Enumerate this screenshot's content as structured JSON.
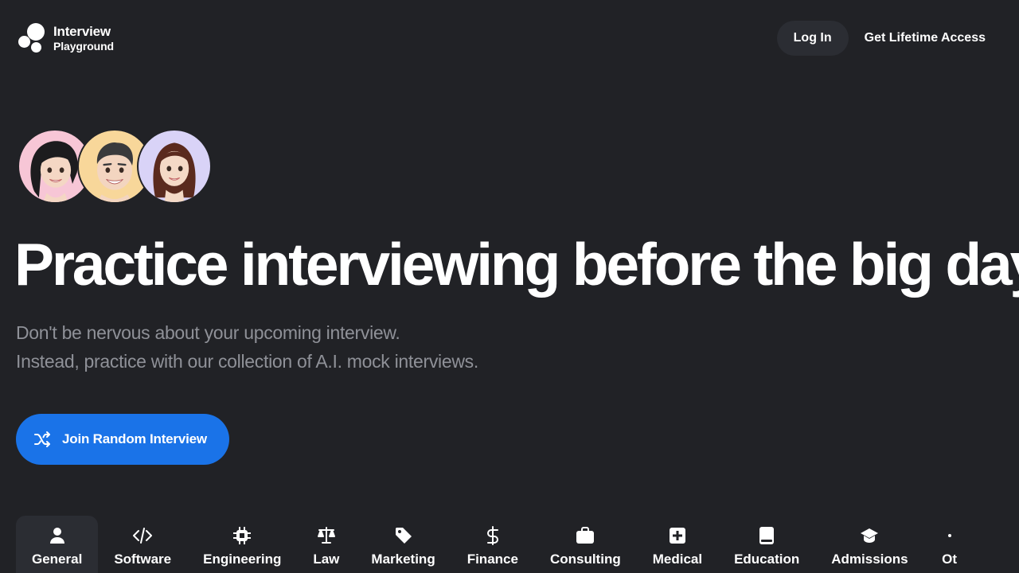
{
  "brand": {
    "name_line1": "Interview",
    "name_line2": "Playground"
  },
  "nav": {
    "login_label": "Log In",
    "lifetime_label": "Get Lifetime Access"
  },
  "hero": {
    "avatars": [
      "avatar-woman-dark-hair",
      "avatar-man-short-hair",
      "avatar-woman-brown-hair"
    ],
    "headline": "Practice interviewing before the big day",
    "subtitle_line1": "Don't be nervous about your upcoming interview.",
    "subtitle_line2": "Instead, practice with our collection of A.I. mock interviews.",
    "cta_label": "Join Random Interview",
    "cta_icon": "shuffle-icon"
  },
  "categories": [
    {
      "label": "General",
      "icon": "user-icon",
      "active": true
    },
    {
      "label": "Software",
      "icon": "code-icon"
    },
    {
      "label": "Engineering",
      "icon": "chip-icon"
    },
    {
      "label": "Law",
      "icon": "scale-icon"
    },
    {
      "label": "Marketing",
      "icon": "tag-icon"
    },
    {
      "label": "Finance",
      "icon": "dollar-icon"
    },
    {
      "label": "Consulting",
      "icon": "briefcase-icon"
    },
    {
      "label": "Medical",
      "icon": "medical-plus-icon"
    },
    {
      "label": "Education",
      "icon": "book-icon"
    },
    {
      "label": "Admissions",
      "icon": "graduation-cap-icon"
    },
    {
      "label": "Ot",
      "icon": "dots-icon"
    }
  ],
  "colors": {
    "background": "#212226",
    "button_dark": "#2b2d33",
    "accent_blue": "#1a73e8",
    "subtitle_gray": "#8f9198"
  }
}
